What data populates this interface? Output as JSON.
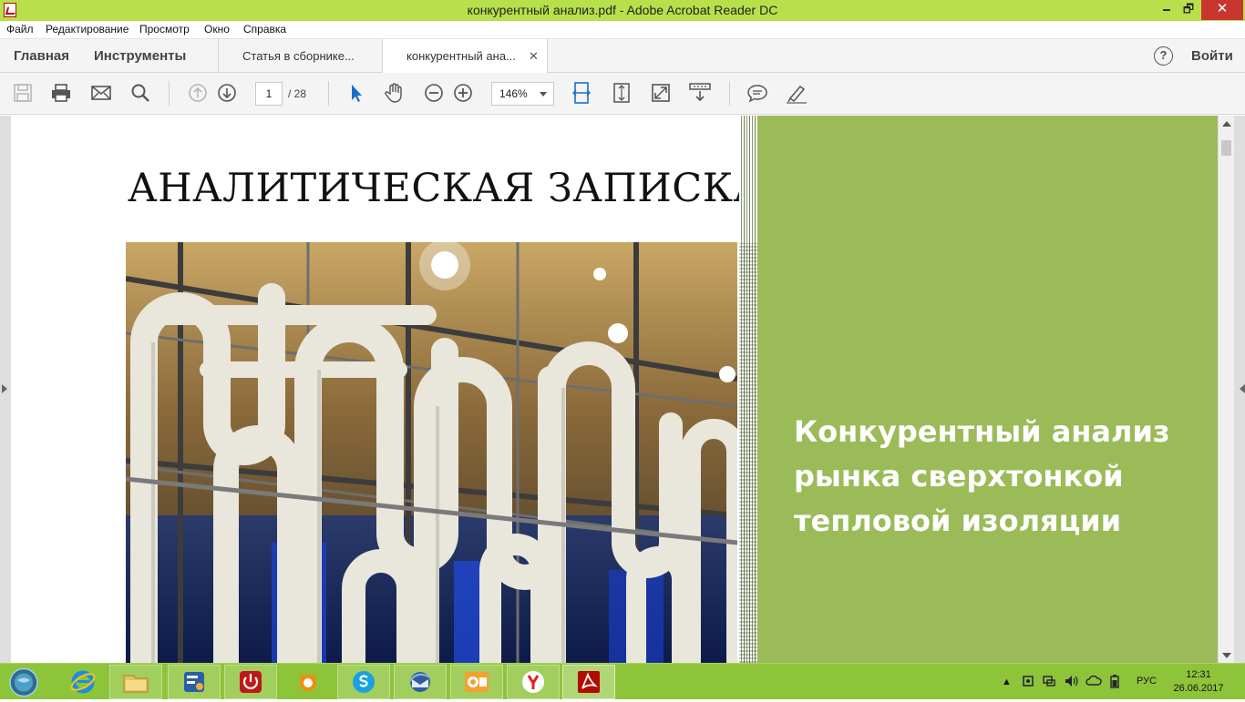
{
  "window": {
    "title": "конкурентный анализ.pdf - Adobe Acrobat Reader DC",
    "minimize": "🗕",
    "maximize": "🗗",
    "close": "✕"
  },
  "menu": [
    "Файл",
    "Редактирование",
    "Просмотр",
    "Окно",
    "Справка"
  ],
  "tabs": {
    "home": "Главная",
    "tools": "Инструменты",
    "documents": [
      {
        "label": "Статья в сборнике...",
        "active": false
      },
      {
        "label": "конкурентный ана...",
        "active": true
      }
    ],
    "close": "✕",
    "help": "?",
    "sign_in": "Войти"
  },
  "toolbar": {
    "icons": [
      "save-icon",
      "print-icon",
      "email-icon",
      "search-icon",
      "page-up-icon",
      "page-down-icon",
      "select-cursor-icon",
      "hand-icon",
      "zoom-out-icon",
      "zoom-in-icon",
      "fit-page-icon",
      "full-screen-icon",
      "expand-icon",
      "scroll-mode-icon",
      "comment-icon",
      "highlight-pen-icon"
    ],
    "page_current": "1",
    "page_total": "/  28",
    "zoom": "146%"
  },
  "document": {
    "heading": "АНАЛИТИЧЕСКАЯ ЗАПИСКА",
    "subtitle": "Конкурентный анализ рынка сверхтонкой тепловой изоляции",
    "panel_color": "#9bbb59"
  },
  "taskbar": {
    "apps": [
      "windows-start",
      "internet-explorer",
      "file-explorer",
      "control-panel",
      "shutdown",
      "avast",
      "skype",
      "thunderbird",
      "outlook",
      "yandex-browser",
      "acrobat-reader"
    ],
    "language": "РУС",
    "time": "12:31",
    "date": "26.06.2017"
  },
  "colors": {
    "titlebar": "#b8e04a",
    "taskbar": "#8ec43a",
    "accent": "#1a6fc9"
  }
}
